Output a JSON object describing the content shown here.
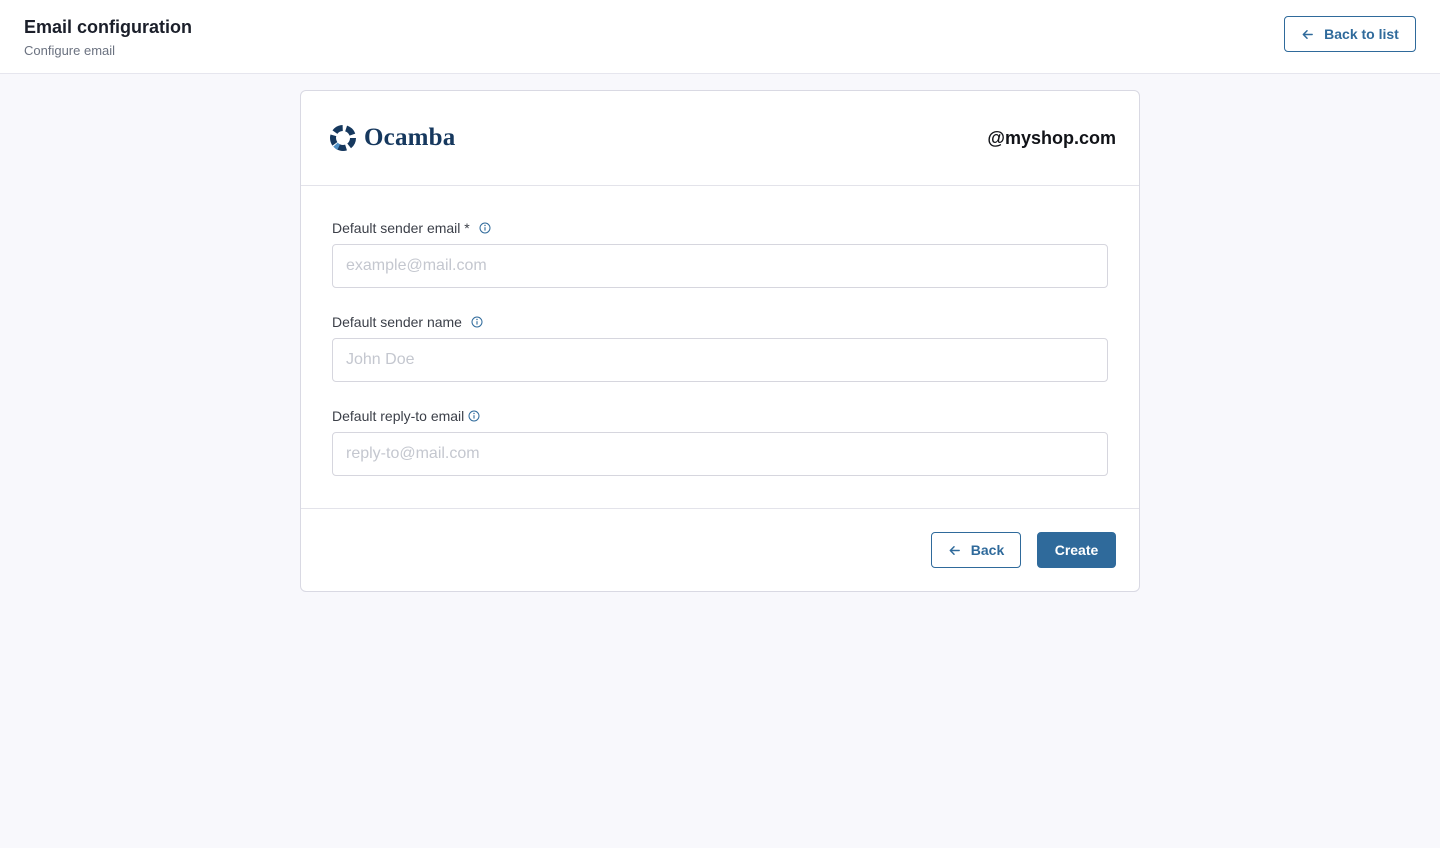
{
  "header": {
    "title": "Email configuration",
    "subtitle": "Configure email",
    "back_to_list_label": "Back to list"
  },
  "card": {
    "logo_text": "Ocamba",
    "domain": "@myshop.com",
    "fields": [
      {
        "label": "Default sender email *",
        "placeholder": "example@mail.com",
        "value": ""
      },
      {
        "label": "Default sender name",
        "placeholder": "John Doe",
        "value": ""
      },
      {
        "label": "Default reply-to email",
        "placeholder": "reply-to@mail.com",
        "value": ""
      }
    ],
    "back_label": "Back",
    "create_label": "Create"
  },
  "icons": {
    "back_arrow": "arrow-left-icon",
    "info": "info-icon",
    "logo": "ocamba-logo-icon"
  },
  "colors": {
    "accent": "#2f6a9b",
    "logo_text": "#16385e",
    "background": "#f8f8fc"
  }
}
